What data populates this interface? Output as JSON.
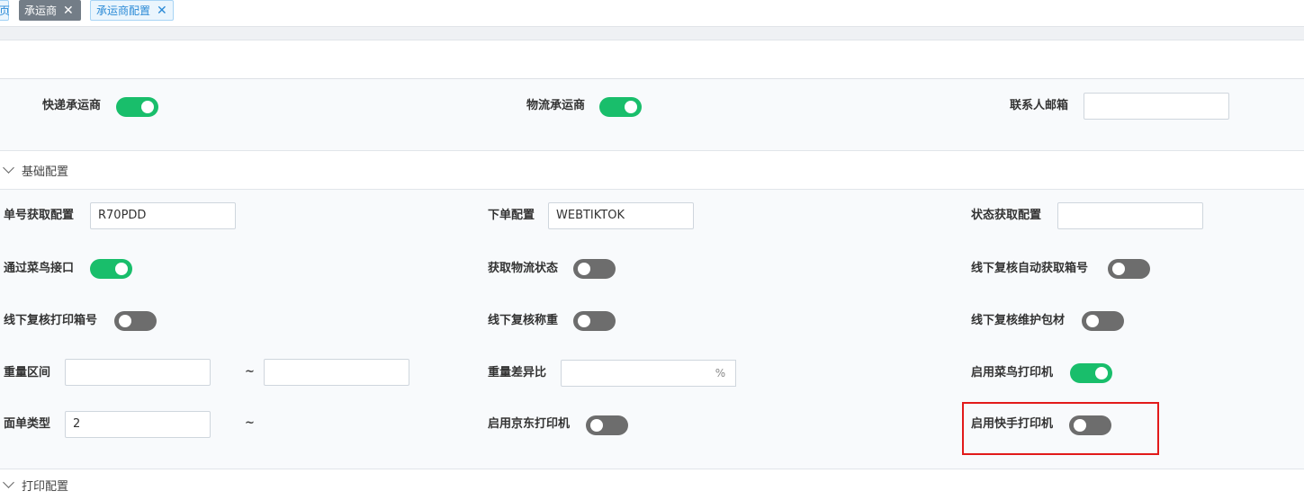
{
  "tabs": [
    {
      "label": "页",
      "closable": false
    },
    {
      "label": "承运商",
      "closable": true
    },
    {
      "label": "承运商配置",
      "closable": true
    }
  ],
  "top_fields": {
    "express_carrier": {
      "label": "快递承运商",
      "on": true
    },
    "logistics_carrier": {
      "label": "物流承运商",
      "on": true
    },
    "contact_email": {
      "label": "联系人邮箱",
      "value": ""
    }
  },
  "basic_section": {
    "title": "基础配置",
    "waybill_config": {
      "label": "单号获取配置",
      "value": "R70PDD"
    },
    "order_config": {
      "label": "下单配置",
      "value": "WEBTIKTOK"
    },
    "status_config": {
      "label": "状态获取配置",
      "value": ""
    },
    "cainiao_interface": {
      "label": "通过菜鸟接口",
      "on": true
    },
    "logistics_status": {
      "label": "获取物流状态",
      "on": false
    },
    "auto_box_no": {
      "label": "线下复核自动获取箱号",
      "on": false
    },
    "print_box_no": {
      "label": "线下复核打印箱号",
      "on": false
    },
    "weighing": {
      "label": "线下复核称重",
      "on": false
    },
    "packaging": {
      "label": "线下复核维护包材",
      "on": false
    },
    "weight_range": {
      "label": "重量区间",
      "min": "",
      "max": "",
      "separator": "~"
    },
    "weight_diff": {
      "label": "重量差异比",
      "value": "",
      "suffix": "%"
    },
    "cainiao_printer": {
      "label": "启用菜鸟打印机",
      "on": true
    },
    "waybill_type": {
      "label": "面单类型",
      "value": "2",
      "separator": "~"
    },
    "jd_printer": {
      "label": "启用京东打印机",
      "on": false
    },
    "kuaishou_printer": {
      "label": "启用快手打印机",
      "on": false
    }
  },
  "print_section": {
    "title": "打印配置"
  },
  "colors": {
    "toggle_on": "#19be6b",
    "toggle_off": "#6d6d6d",
    "highlight": "#e21a1a",
    "tab_active": "#737d87"
  }
}
